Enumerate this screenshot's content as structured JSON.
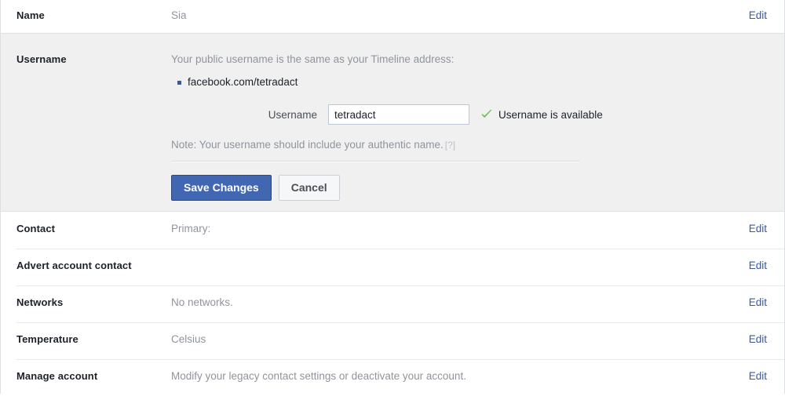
{
  "rows": {
    "name": {
      "label": "Name",
      "value": "Sia",
      "edit": "Edit"
    },
    "username": {
      "label": "Username",
      "intro": "Your public username is the same as your Timeline address:",
      "timeline_url": "facebook.com/tetradact",
      "field_label": "Username",
      "field_value": "tetradact",
      "field_placeholder": "",
      "availability_text": "Username is available",
      "availability_icon": "green-check-icon",
      "note": "Note: Your username should include your authentic name.",
      "help_marker": "[?]",
      "save_label": "Save Changes",
      "cancel_label": "Cancel"
    },
    "contact": {
      "label": "Contact",
      "value": "Primary:",
      "edit": "Edit"
    },
    "advert_account_contact": {
      "label": "Advert account contact",
      "value": "",
      "edit": "Edit"
    },
    "networks": {
      "label": "Networks",
      "value": "No networks.",
      "edit": "Edit"
    },
    "temperature": {
      "label": "Temperature",
      "value": "Celsius",
      "edit": "Edit"
    },
    "manage_account": {
      "label": "Manage account",
      "value": "Modify your legacy contact settings or deactivate your account.",
      "edit": "Edit"
    }
  },
  "colors": {
    "accent_blue": "#3b5998",
    "button_blue": "#4267b2",
    "check_green": "#6ac259",
    "muted_text": "#90949c",
    "panel_grey": "#f0f0f0"
  }
}
